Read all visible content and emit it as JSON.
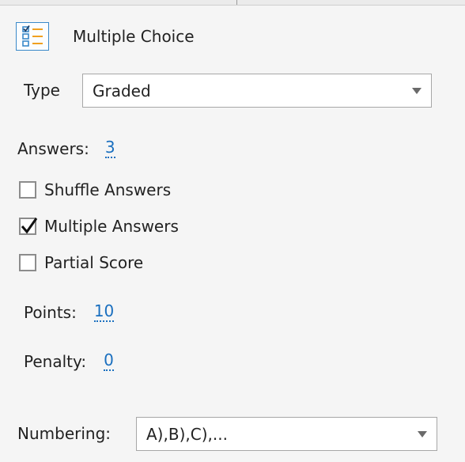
{
  "header": {
    "title": "Multiple Choice",
    "icon": "checklist-icon"
  },
  "type_field": {
    "label": "Type",
    "selected": "Graded"
  },
  "answers": {
    "label": "Answers:",
    "value": "3"
  },
  "options": [
    {
      "label": "Shuffle Answers",
      "checked": false
    },
    {
      "label": "Multiple Answers",
      "checked": true
    },
    {
      "label": "Partial Score",
      "checked": false
    }
  ],
  "points": {
    "label": "Points:",
    "value": "10"
  },
  "penalty": {
    "label": "Penalty:",
    "value": "0"
  },
  "numbering": {
    "label": "Numbering:",
    "selected": "A),B),C),..."
  },
  "colors": {
    "accent": "#1a6fbf",
    "icon_blue": "#3a89c9",
    "icon_orange": "#f0a020"
  }
}
